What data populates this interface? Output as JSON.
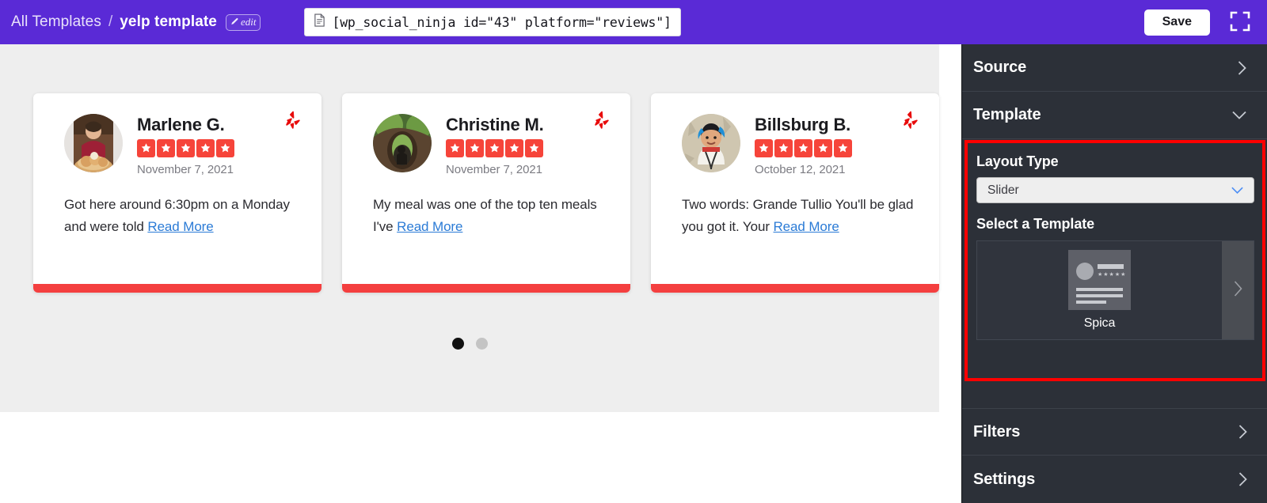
{
  "topbar": {
    "breadcrumb_root": "All Templates",
    "breadcrumb_separator": "/",
    "breadcrumb_current": "yelp template",
    "edit_label": "edit",
    "edit_icon": "pencil-icon",
    "shortcode": "[wp_social_ninja id=\"43\" platform=\"reviews\"]",
    "shortcode_icon": "document-icon",
    "save_label": "Save",
    "fullscreen_icon": "fullscreen-icon",
    "accent_color": "#5a2ad6"
  },
  "preview": {
    "platform_icon": "yelp-burst-icon",
    "read_more_label": "Read More",
    "accent_color": "#f43f3f",
    "link_color": "#2b7bd6",
    "star_color": "#f6443a",
    "cards": [
      {
        "name": "Marlene G.",
        "rating": 5,
        "date": "November 7, 2021",
        "text": "Got here around 6:30pm on a Monday and were told ",
        "avatar": "avatar-marlene"
      },
      {
        "name": "Christine M.",
        "rating": 5,
        "date": "November 7, 2021",
        "text": "My meal was one of the top ten meals I've ",
        "avatar": "avatar-christine"
      },
      {
        "name": "Billsburg B.",
        "rating": 5,
        "date": "October 12, 2021",
        "text": "Two words: Grande Tullio You'll be glad you got it. Your ",
        "avatar": "avatar-billsburg"
      }
    ],
    "pagination": {
      "total": 2,
      "active_index": 0
    }
  },
  "sidebar": {
    "sections": [
      {
        "label": "Source",
        "state": "collapsed",
        "icon": "chevron-right-icon"
      },
      {
        "label": "Template",
        "state": "expanded",
        "icon": "chevron-down-icon"
      },
      {
        "label": "Filters",
        "state": "collapsed",
        "icon": "chevron-right-icon"
      },
      {
        "label": "Settings",
        "state": "collapsed",
        "icon": "chevron-right-icon"
      }
    ],
    "template_panel": {
      "highlight_color": "#fe0000",
      "layout_type_label": "Layout Type",
      "layout_type_value": "Slider",
      "layout_type_chevron": "chevron-down-icon",
      "select_template_label": "Select a Template",
      "templates": [
        {
          "name": "Spica",
          "thumbnail": "card-preview-thumb"
        }
      ],
      "next_icon": "chevron-right-icon"
    }
  }
}
